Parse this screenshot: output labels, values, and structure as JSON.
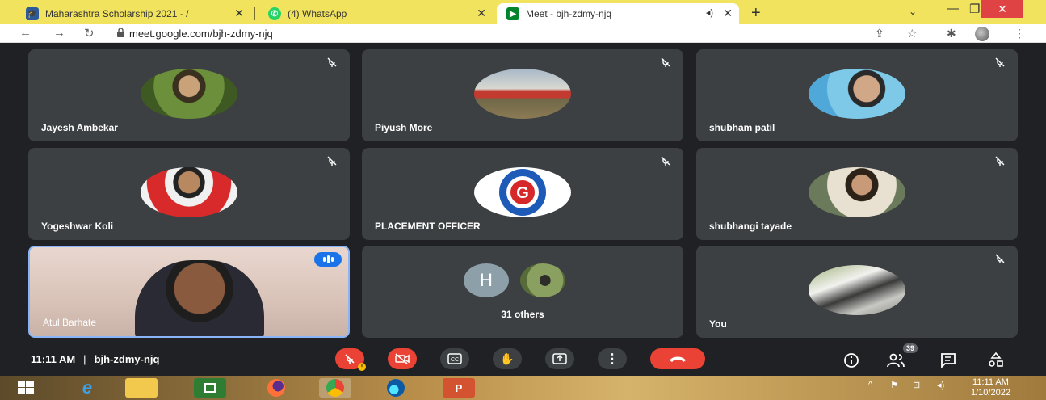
{
  "browser": {
    "tabs": [
      {
        "label": "Maharashtra Scholarship 2021 - /",
        "close": "✕"
      },
      {
        "label": "(4) WhatsApp",
        "close": "✕"
      },
      {
        "label": "Meet - bjh-zdmy-njq",
        "close": "✕"
      }
    ],
    "new_tab": "+",
    "url": "meet.google.com/bjh-zdmy-njq"
  },
  "tiles": [
    {
      "name": "Jayesh Ambekar"
    },
    {
      "name": "Piyush More"
    },
    {
      "name": "shubham patil"
    },
    {
      "name": "Yogeshwar Koli"
    },
    {
      "name": "PLACEMENT OFFICER"
    },
    {
      "name": "shubhangi tayade"
    },
    {
      "name": "Atul Barhate"
    },
    {
      "name": "31 others",
      "initial": "H"
    },
    {
      "name": "You"
    }
  ],
  "meeting": {
    "time": "11:11 AM",
    "separator": "|",
    "code": "bjh-zdmy-njq",
    "participant_count": "39"
  },
  "taskbar": {
    "time": "11:11 AM",
    "date": "1/10/2022"
  },
  "colors": {
    "accent": "#8ab4f8",
    "danger": "#ea4335",
    "tile_bg": "#3c4043",
    "tab_strip": "#f2e35f"
  }
}
